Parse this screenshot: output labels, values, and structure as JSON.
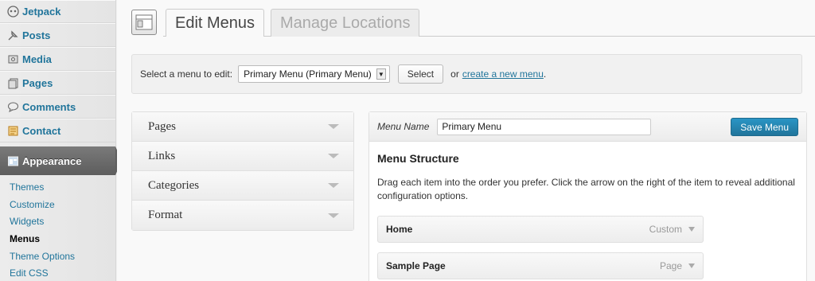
{
  "sidebar": {
    "items": [
      {
        "label": "Jetpack",
        "icon": "jetpack-icon"
      },
      {
        "label": "Posts",
        "icon": "pin-icon"
      },
      {
        "label": "Media",
        "icon": "media-icon"
      },
      {
        "label": "Pages",
        "icon": "pages-icon"
      },
      {
        "label": "Comments",
        "icon": "comment-icon"
      },
      {
        "label": "Contact",
        "icon": "contact-icon"
      }
    ],
    "active": {
      "label": "Appearance",
      "icon": "appearance-icon"
    },
    "subitems": [
      "Themes",
      "Customize",
      "Widgets",
      "Menus",
      "Theme Options",
      "Edit CSS"
    ]
  },
  "tabs": {
    "active": "Edit Menus",
    "inactive": "Manage Locations"
  },
  "select_bar": {
    "prompt": "Select a menu to edit:",
    "selected": "Primary Menu (Primary Menu)",
    "select_button": "Select",
    "or_text": "or",
    "create_link": "create a new menu",
    "period": "."
  },
  "accordion": [
    "Pages",
    "Links",
    "Categories",
    "Format"
  ],
  "editor": {
    "name_label": "Menu Name",
    "name_value": "Primary Menu",
    "save_label": "Save Menu",
    "structure_title": "Menu Structure",
    "description": "Drag each item into the order you prefer. Click the arrow on the right of the item to reveal additional configuration options.",
    "items": [
      {
        "title": "Home",
        "type": "Custom"
      },
      {
        "title": "Sample Page",
        "type": "Page"
      }
    ]
  },
  "colors": {
    "link": "#21759b",
    "primary_button": "#21759b",
    "active_nav": "#5d5d5d"
  }
}
